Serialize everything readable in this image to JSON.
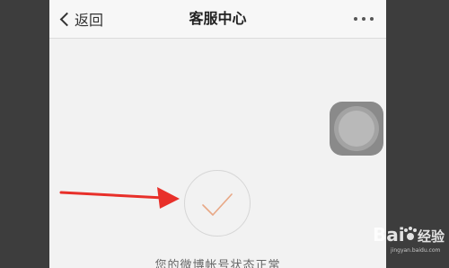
{
  "navbar": {
    "back_label": "返回",
    "title": "客服中心",
    "more_icon": "more-dots-icon"
  },
  "main": {
    "status_icon": "checkmark-icon",
    "status_text": "您的微博帐号状态正常"
  },
  "overlay": {
    "assistive_touch_icon": "assistive-touch-icon",
    "annotation_arrow_color": "#e8302a"
  },
  "watermark": {
    "brand": "Bai",
    "brand_suffix": "经验",
    "tag": "jingyan.baidu.com"
  },
  "colors": {
    "checkmark": "#e8a886",
    "background": "#f2f2f2",
    "navbar": "#f7f7f7"
  }
}
